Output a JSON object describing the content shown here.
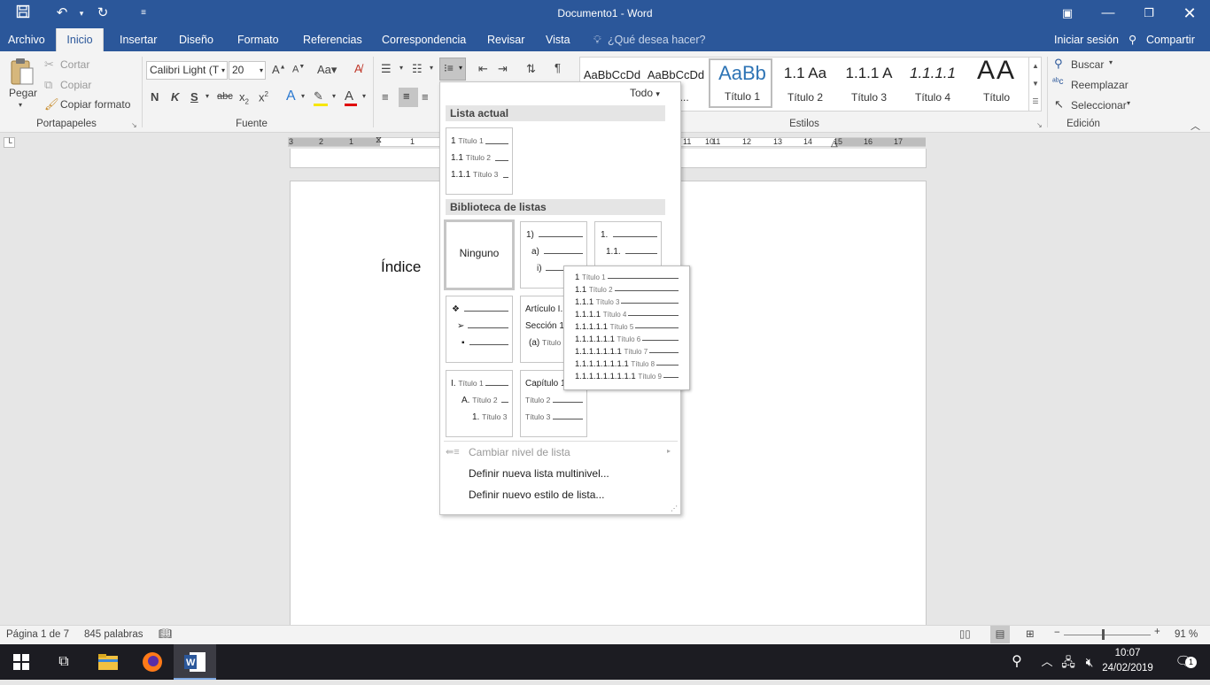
{
  "title": "Documento1 - Word",
  "tabs": [
    "Archivo",
    "Inicio",
    "Insertar",
    "Diseño",
    "Formato",
    "Referencias",
    "Correspondencia",
    "Revisar",
    "Vista"
  ],
  "tell_me": "¿Qué desea hacer?",
  "sign_in": "Iniciar sesión",
  "share": "Compartir",
  "clipboard": {
    "paste": "Pegar",
    "cut": "Cortar",
    "copy": "Copiar",
    "format_painter": "Copiar formato",
    "group": "Portapapeles"
  },
  "font": {
    "name": "Calibri Light (T",
    "size": "20",
    "group": "Fuente"
  },
  "styles": {
    "group": "Estilos",
    "items": [
      {
        "preview": "AaBbCcDd",
        "name": ""
      },
      {
        "preview": "AaBbCcDd",
        "name": "spa..."
      },
      {
        "preview": "AaBb",
        "name": "Título 1"
      },
      {
        "preview": "1.1  Aa",
        "name": "Título 2"
      },
      {
        "preview": "1.1.1  A",
        "name": "Título 3"
      },
      {
        "preview": "1.1.1.1",
        "name": "Título 4"
      },
      {
        "preview": "AA",
        "name": "Título"
      }
    ]
  },
  "editing": {
    "group": "Edición",
    "find": "Buscar",
    "replace": "Reemplazar",
    "select": "Seleccionar"
  },
  "ruler": {
    "numbers": [
      "3",
      "2",
      "1",
      "1",
      "11",
      "10",
      "11",
      "12",
      "13",
      "14",
      "15",
      "16",
      "17"
    ]
  },
  "document": {
    "heading": "Índice"
  },
  "menu": {
    "filter": "Todo",
    "current_header": "Lista actual",
    "current": [
      {
        "num": "1",
        "label": "Título 1"
      },
      {
        "num": "1.1",
        "label": "Título 2"
      },
      {
        "num": "1.1.1",
        "label": "Título 3"
      }
    ],
    "library_header": "Biblioteca de listas",
    "none": "Ninguno",
    "lib_b": [
      "1)",
      "a)",
      "i)"
    ],
    "lib_c": [
      "1.",
      "1.1."
    ],
    "lib_d": [
      "❖",
      "➢",
      "▪"
    ],
    "lib_e": [
      {
        "num": "Artículo I.",
        "label": ""
      },
      {
        "num": "Sección 1",
        "label": ""
      },
      {
        "num": "(a)",
        "label": "Título"
      }
    ],
    "lib_f": [
      {
        "num": "I.",
        "label": "Título 1"
      },
      {
        "num": "A.",
        "label": "Título 2"
      },
      {
        "num": "1.",
        "label": "Título 3"
      }
    ],
    "lib_g": [
      {
        "num": "Capítulo 1",
        "label": ""
      },
      {
        "num": "",
        "label": "Título 2"
      },
      {
        "num": "",
        "label": "Título 3"
      }
    ],
    "change_level": "Cambiar nivel de lista",
    "define_multilevel": "Definir nueva lista multinivel...",
    "define_style": "Definir nuevo estilo de lista..."
  },
  "preview_tip": [
    {
      "num": "1",
      "label": "Título 1"
    },
    {
      "num": "1.1",
      "label": "Título 2"
    },
    {
      "num": "1.1.1",
      "label": "Título 3"
    },
    {
      "num": "1.1.1.1",
      "label": "Título 4"
    },
    {
      "num": "1.1.1.1.1",
      "label": "Título 5"
    },
    {
      "num": "1.1.1.1.1.1",
      "label": "Título 6"
    },
    {
      "num": "1.1.1.1.1.1.1",
      "label": "Título 7"
    },
    {
      "num": "1.1.1.1.1.1.1.1",
      "label": "Título 8"
    },
    {
      "num": "1.1.1.1.1.1.1.1.1",
      "label": "Título 9"
    }
  ],
  "status": {
    "page": "Página 1 de 7",
    "words": "845 palabras",
    "zoom": "91 %"
  },
  "clock": {
    "time": "10:07",
    "date": "24/02/2019"
  },
  "notifications": "1",
  "colors": {
    "accent": "#2b579a",
    "taskbar": "#1c1c22"
  }
}
